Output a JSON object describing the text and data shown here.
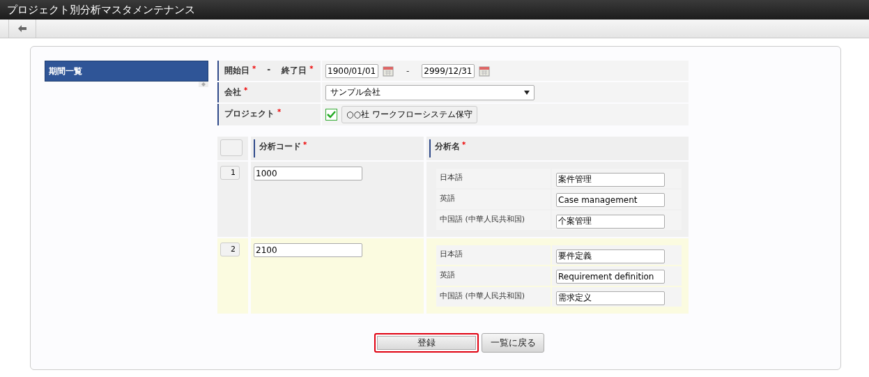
{
  "window": {
    "title": "プロジェクト別分析マスタメンテナンス"
  },
  "sidebar": {
    "items": [
      {
        "label": "期間一覧",
        "selected": true
      }
    ]
  },
  "form": {
    "period": {
      "start_label": "開始日",
      "start_mark": "*",
      "separator": "-",
      "end_label": "終了日",
      "end_mark": "*",
      "start": "1900/01/01",
      "range_separator": "-",
      "end": "2999/12/31"
    },
    "company": {
      "label": "会社",
      "required_mark": "*",
      "value": "サンプル会社"
    },
    "project": {
      "label": "プロジェクト",
      "required_mark": "*",
      "value": "○○社 ワークフローシステム保守",
      "checked": true
    }
  },
  "table": {
    "columns": [
      {
        "label": "分析コード",
        "required_mark": "*"
      },
      {
        "label": "分析名",
        "required_mark": "*"
      }
    ],
    "rows": [
      {
        "number": "1",
        "code": "1000",
        "highlighted": false,
        "names": [
          {
            "language": "日本語",
            "value": "案件管理"
          },
          {
            "language": "英語",
            "value": "Case management"
          },
          {
            "language": "中国語 (中華人民共和国)",
            "value": "个案管理"
          }
        ]
      },
      {
        "number": "2",
        "code": "2100",
        "highlighted": true,
        "names": [
          {
            "language": "日本語",
            "value": "要件定義"
          },
          {
            "language": "英語",
            "value": "Requirement definition"
          },
          {
            "language": "中国語 (中華人民共和国)",
            "value": "需求定义"
          }
        ]
      }
    ]
  },
  "buttons": [
    {
      "label": "登録",
      "highlighted": true
    },
    {
      "label": "一覧に戻る",
      "highlighted": false
    }
  ]
}
